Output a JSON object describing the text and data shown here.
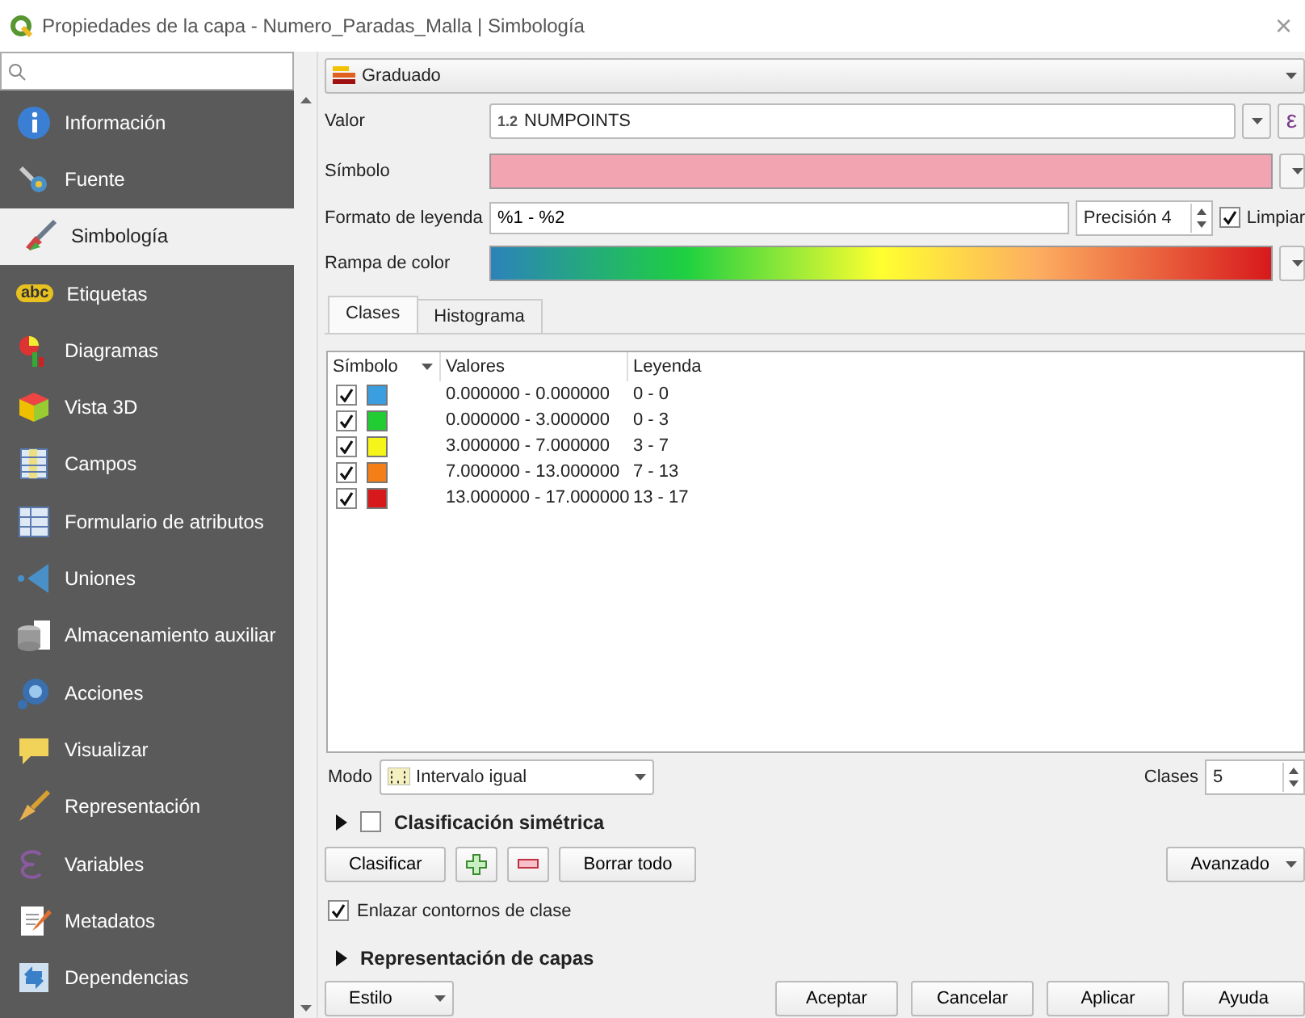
{
  "window": {
    "title": "Propiedades de la capa - Numero_Paradas_Malla | Simbología",
    "close": "×"
  },
  "sidebar": {
    "items": [
      {
        "label": "Información",
        "selected": false
      },
      {
        "label": "Fuente",
        "selected": false
      },
      {
        "label": "Simbología",
        "selected": true
      },
      {
        "label": "Etiquetas",
        "selected": false,
        "badge": "abc"
      },
      {
        "label": "Diagramas",
        "selected": false
      },
      {
        "label": "Vista 3D",
        "selected": false
      },
      {
        "label": "Campos",
        "selected": false
      },
      {
        "label": "Formulario de atributos",
        "selected": false
      },
      {
        "label": "Uniones",
        "selected": false
      },
      {
        "label": "Almacenamiento auxiliar",
        "selected": false
      },
      {
        "label": "Acciones",
        "selected": false
      },
      {
        "label": "Visualizar",
        "selected": false
      },
      {
        "label": "Representación",
        "selected": false
      },
      {
        "label": "Variables",
        "selected": false
      },
      {
        "label": "Metadatos",
        "selected": false
      },
      {
        "label": "Dependencias",
        "selected": false
      }
    ]
  },
  "renderer": {
    "value": "Graduado"
  },
  "value_field": {
    "label": "Valor",
    "type_badge": "1.2",
    "value": "NUMPOINTS",
    "expression_button": "ε"
  },
  "symbol": {
    "label": "Símbolo"
  },
  "legend_format": {
    "label": "Formato de leyenda",
    "value": "%1 - %2",
    "precision": "Precisión 4",
    "trim": {
      "label": "Limpiar",
      "checked": true
    }
  },
  "color_ramp": {
    "label": "Rampa de color"
  },
  "tabs": [
    {
      "label": "Clases",
      "selected": true
    },
    {
      "label": "Histograma",
      "selected": false
    }
  ],
  "table": {
    "columns": [
      "Símbolo",
      "Valores",
      "Leyenda"
    ],
    "rows": [
      {
        "checked": true,
        "color": "#3a9ee0",
        "values": "0.000000 - 0.000000",
        "legend": "0 - 0"
      },
      {
        "checked": true,
        "color": "#22cc33",
        "values": "0.000000 - 3.000000",
        "legend": "0 - 3"
      },
      {
        "checked": true,
        "color": "#f5f51a",
        "values": "3.000000 - 7.000000",
        "legend": "3 - 7"
      },
      {
        "checked": true,
        "color": "#f57f17",
        "values": "7.000000 - 13.000000",
        "legend": "7 - 13"
      },
      {
        "checked": true,
        "color": "#d7191c",
        "values": "13.000000 - 17.000000",
        "legend": "13 - 17"
      }
    ]
  },
  "mode": {
    "label": "Modo",
    "value": "Intervalo igual"
  },
  "classes": {
    "label": "Clases",
    "value": "5"
  },
  "symmetric": {
    "label": "Clasificación simétrica",
    "checked": false,
    "expanded": false
  },
  "actions": {
    "classify": "Clasificar",
    "delete_all": "Borrar todo",
    "advanced": "Avanzado"
  },
  "link_boundaries": {
    "label": "Enlazar contornos de clase",
    "checked": true
  },
  "layer_rendering": {
    "label": "Representación de capas",
    "expanded": false
  },
  "footer": {
    "style": "Estilo",
    "buttons": [
      "Aceptar",
      "Cancelar",
      "Aplicar",
      "Ayuda"
    ]
  }
}
